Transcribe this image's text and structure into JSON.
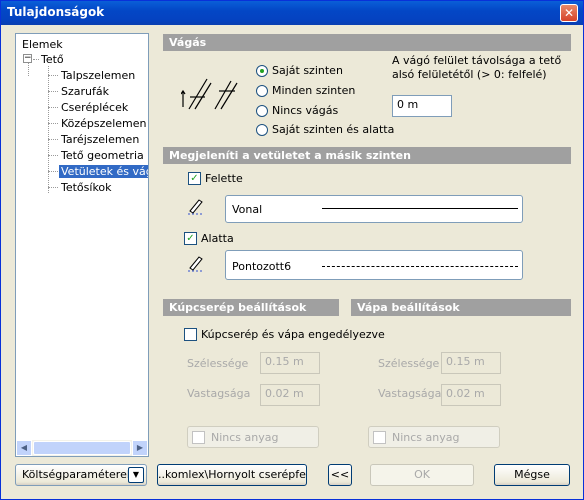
{
  "window": {
    "title": "Tulajdonságok",
    "close_label": "✕"
  },
  "tree": {
    "root": "Elemek",
    "group": "Tető",
    "expander": "−",
    "items": [
      "Talpszelemen",
      "Szarufák",
      "Cseréplécek",
      "Középszelemen",
      "Taréjszelemen",
      "Tető geometria",
      "Vetületek és vágás",
      "Tetősíkok"
    ],
    "selected_index": 6,
    "scroll_left": "◀",
    "scroll_right": "▶"
  },
  "cut": {
    "title": "Vágás",
    "options": [
      "Saját szinten",
      "Minden szinten",
      "Nincs vágás",
      "Saját szinten és alatta"
    ],
    "selected_index": 0,
    "distance_label": "A vágó felület távolsága a tető alsó felületétől (> 0: felfelé)",
    "distance_value": "0 m"
  },
  "projection": {
    "title": "Megjeleníti a vetületet a másik szinten",
    "above": {
      "label": "Felette",
      "checked": true,
      "line_type": "Vonal"
    },
    "below": {
      "label": "Alatta",
      "checked": true,
      "line_type": "Pontozott6"
    },
    "check_mark": "✓"
  },
  "ridge": {
    "title": "Kúpcserép beállítások",
    "width_label": "Szélessége",
    "width_value": "0.15 m",
    "thickness_label": "Vastagsága",
    "thickness_value": "0.02 m",
    "material_label": "Nincs anyag"
  },
  "valley": {
    "title": "Vápa beállítások",
    "width_label": "Szélessége",
    "width_value": "0.15 m",
    "thickness_label": "Vastagsága",
    "thickness_value": "0.02 m",
    "material_label": "Nincs anyag"
  },
  "enable": {
    "label": "Kúpcserép és vápa engedélyezve",
    "checked": false
  },
  "footer": {
    "cost_label": "Költségparaméterek",
    "dropdown_arrow": "▼",
    "path_label": "..komlex\\Hornyolt cserépfedés",
    "back_label": "<<",
    "ok_label": "OK",
    "cancel_label": "Mégse"
  }
}
